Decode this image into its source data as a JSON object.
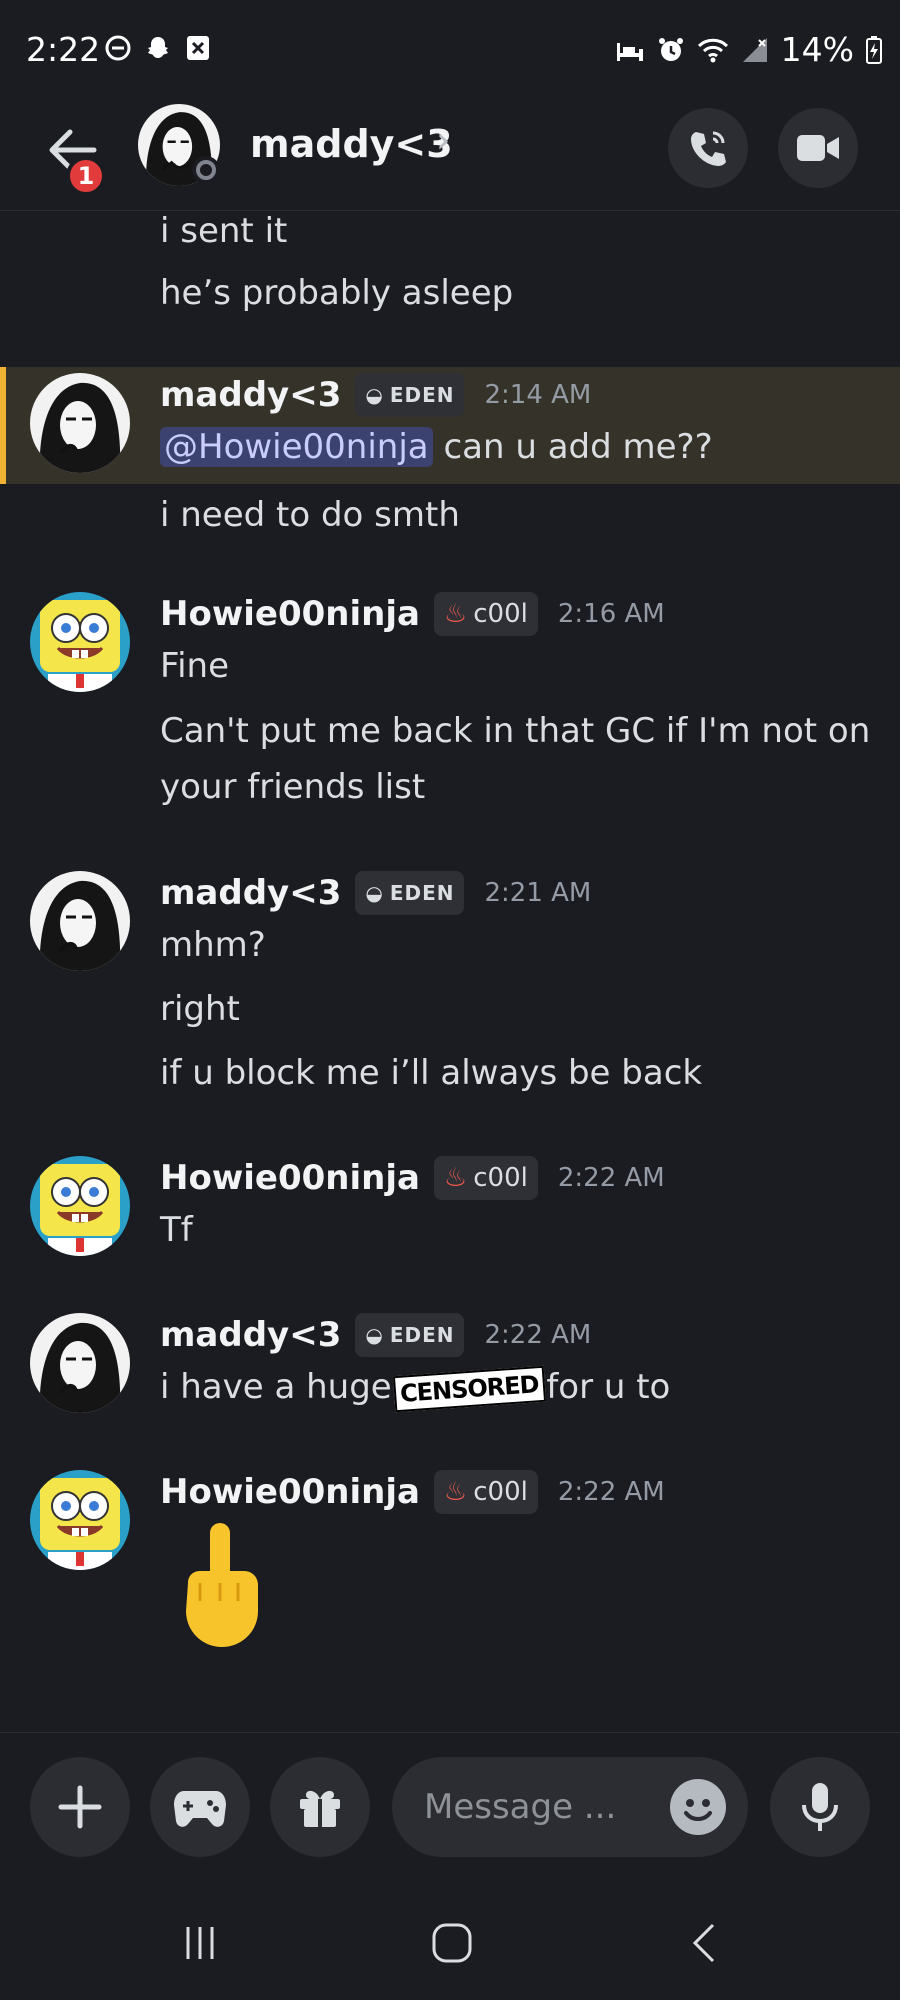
{
  "status_bar": {
    "time": "2:22",
    "battery": "14%"
  },
  "header": {
    "title": "maddy<3",
    "back_badge": "1"
  },
  "messages": {
    "top_lines": [
      "i sent it",
      "he’s probably asleep"
    ],
    "groups": [
      {
        "author": "maddy<3",
        "tag": "EDEN",
        "time": "2:14 AM",
        "mention": "@Howie00ninja",
        "first_text": "can u add me??",
        "lines": [
          "i need to do smth"
        ]
      },
      {
        "author": "Howie00ninja",
        "tag": "c00l",
        "time": "2:16 AM",
        "lines": [
          "Fine",
          "Can't put me back in that GC if I'm not on",
          "your friends list"
        ]
      },
      {
        "author": "maddy<3",
        "tag": "EDEN",
        "time": "2:21 AM",
        "lines": [
          "mhm?",
          "right",
          "if u block me i’ll always be back"
        ]
      },
      {
        "author": "Howie00ninja",
        "tag": "c00l",
        "time": "2:22 AM",
        "lines": [
          "Tf"
        ]
      },
      {
        "author": "maddy<3",
        "tag": "EDEN",
        "time": "2:22 AM",
        "text_before": "i have a huge",
        "censor_label": "CENSORED",
        "text_after": "for u to"
      },
      {
        "author": "Howie00ninja",
        "tag": "c00l",
        "time": "2:22 AM",
        "emoji": "middle-finger"
      }
    ]
  },
  "input": {
    "placeholder": "Message ..."
  },
  "colors": {
    "background": "#1b1c21",
    "highlight": "#35322a",
    "highlight_border": "#f0b232",
    "badge": "#e23b3b",
    "mention_bg": "#3c4270"
  }
}
